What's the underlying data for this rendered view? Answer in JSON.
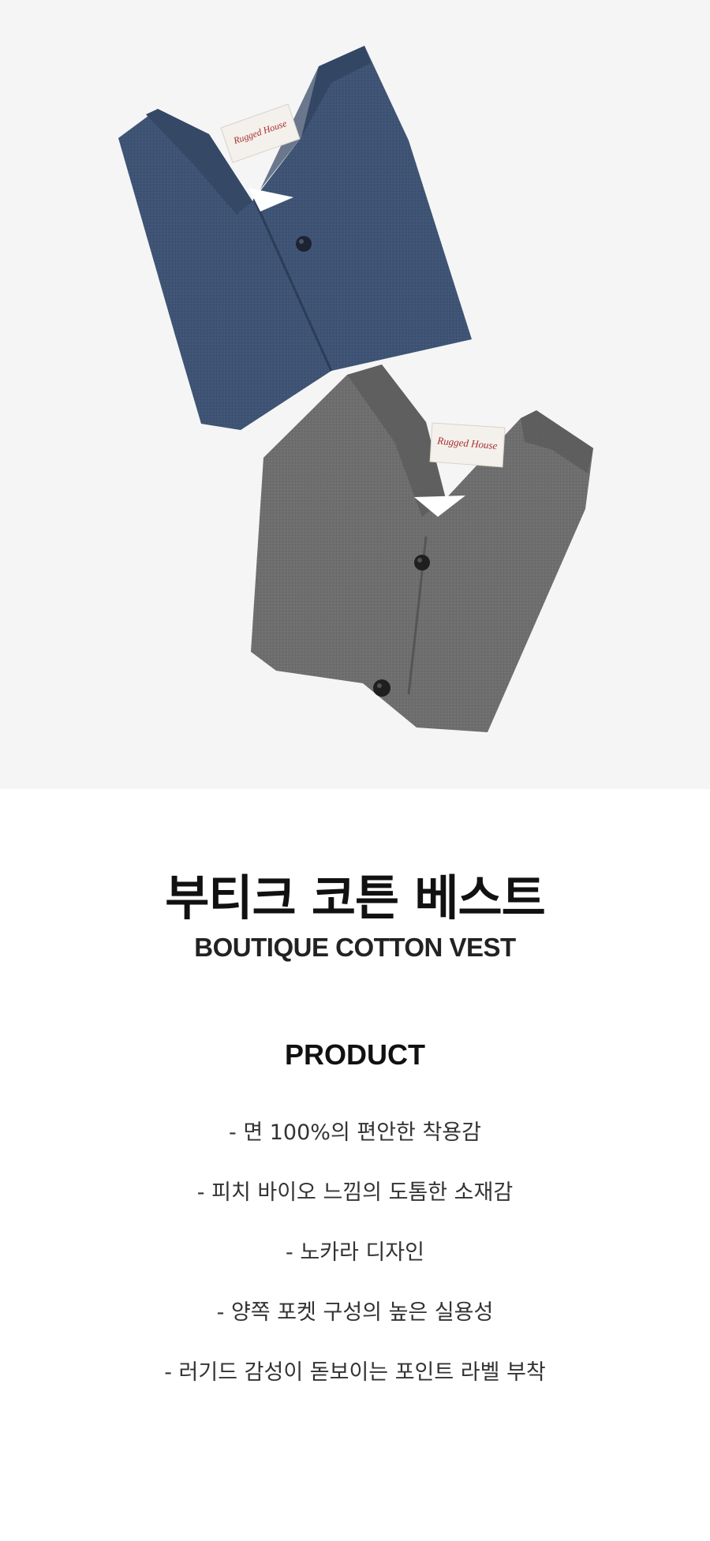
{
  "hero": {
    "image": "product-photo: two folded v-neck vests, navy blue and gray, each with a woven brand label",
    "label_text": "Rugged House",
    "colors": {
      "background": "#f5f5f5",
      "navy_vest": "#3f5474",
      "gray_vest": "#6e6e6e",
      "label_red": "#a82d2d"
    }
  },
  "product": {
    "title_ko": "부티크 코튼 베스트",
    "title_en": "BOUTIQUE COTTON VEST"
  },
  "details": {
    "heading": "PRODUCT",
    "items": [
      "- 면 100%의 편안한 착용감",
      "- 피치 바이오 느낌의 도톰한 소재감",
      "- 노카라 디자인",
      "- 양쪽 포켓 구성의 높은 실용성",
      "- 러기드 감성이 돋보이는 포인트 라벨 부착"
    ]
  }
}
